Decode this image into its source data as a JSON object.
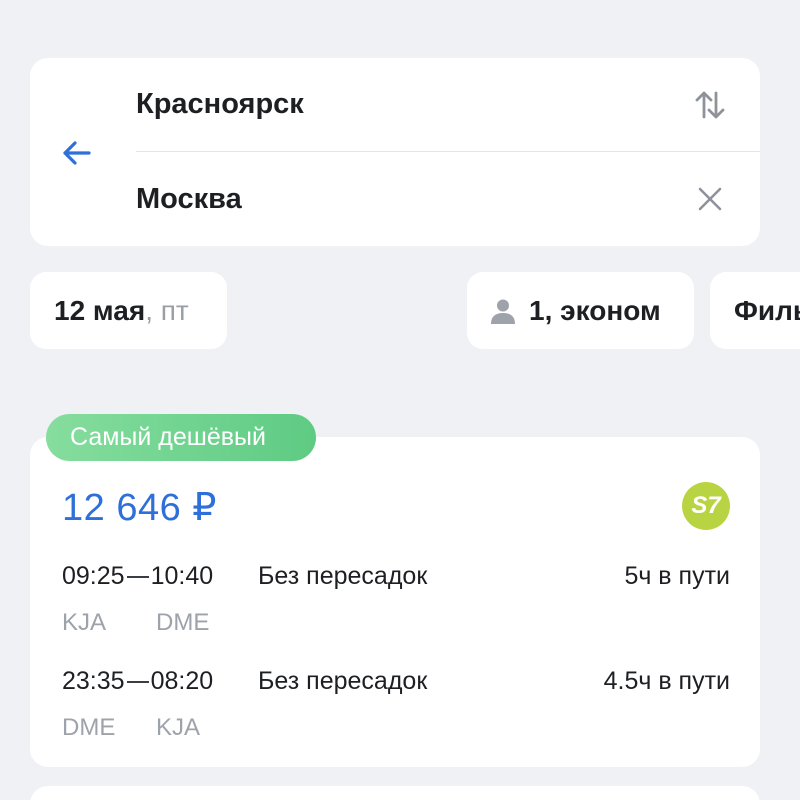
{
  "route": {
    "from": "Красноярск",
    "to": "Москва",
    "back_icon": "arrow-left-icon",
    "swap_icon": "swap-vertical-icon",
    "clear_icon": "close-icon"
  },
  "filters": {
    "date": "12 мая",
    "weekday": ", пт",
    "passengers": "1, эконом",
    "passenger_icon": "person-icon",
    "filter_label": "Фильтры"
  },
  "offer": {
    "badge": "Самый дешёвый",
    "price": "12 646 ₽",
    "airline_logo_text": "S7",
    "legs": [
      {
        "depart": "09:25",
        "arrive": "10:40",
        "from_code": "KJA",
        "to_code": "DME",
        "stops": "Без пересадок",
        "duration": "5ч в пути"
      },
      {
        "depart": "23:35",
        "arrive": "08:20",
        "from_code": "DME",
        "to_code": "KJA",
        "stops": "Без пересадок",
        "duration": "4.5ч в пути"
      }
    ]
  },
  "colors": {
    "accent": "#2e6fd9",
    "badge_green": "#6fd48c",
    "s7_green": "#b9d442",
    "background": "#eff1f5"
  }
}
